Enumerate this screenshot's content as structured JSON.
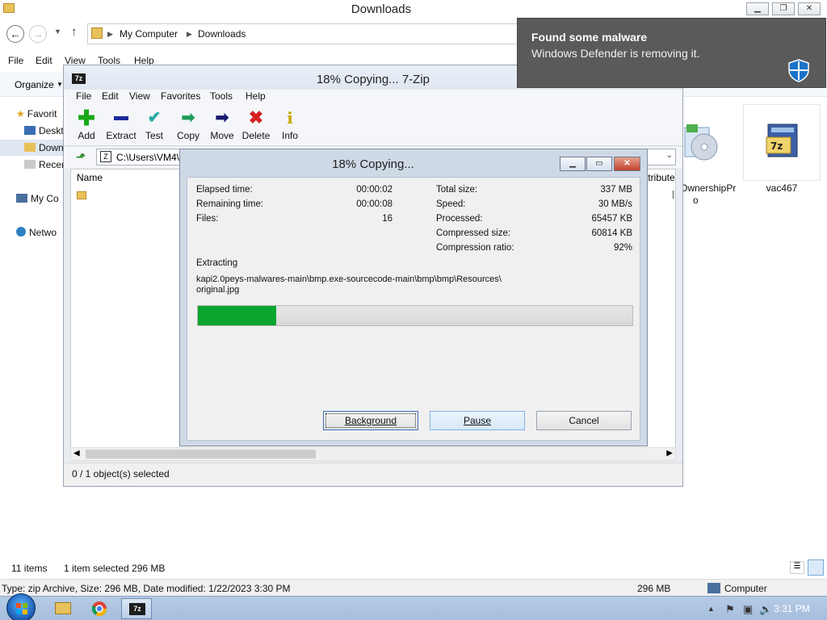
{
  "explorer": {
    "title": "Downloads",
    "address_parts": [
      "My Computer",
      "Downloads"
    ],
    "menu": [
      "File",
      "Edit",
      "View",
      "Tools",
      "Help"
    ],
    "organize_label": "Organize",
    "nav_items": [
      "Favorit",
      "Deskt",
      "Down",
      "Recen",
      "My Co",
      "Netwo"
    ],
    "files": [
      {
        "name": "OwnershipPr",
        "name2": "o",
        "icon": "disc-setup-icon"
      },
      {
        "name": "vac467",
        "icon": "7zip-archive-icon"
      }
    ],
    "status": {
      "items": "11 items",
      "selected": "1 item selected  296 MB"
    },
    "details": {
      "type_text": "Type: zip Archive, Size: 296 MB, Date modified: 1/22/2023 3:30 PM",
      "size": "296 MB",
      "location": "Computer"
    }
  },
  "sevenzip": {
    "title": "18% Copying... 7-Zip",
    "app_icon_text": "7z",
    "menu": [
      "File",
      "Edit",
      "View",
      "Favorites",
      "Tools",
      "Help"
    ],
    "toolbar": [
      "Add",
      "Extract",
      "Test",
      "Copy",
      "Move",
      "Delete",
      "Info"
    ],
    "path": "C:\\Users\\VM4\\",
    "column_name": "Name",
    "column_attr": "ttribute",
    "status": "0 / 1 object(s) selected"
  },
  "dialog": {
    "title": "18% Copying...",
    "elapsed_label": "Elapsed time:",
    "elapsed": "00:00:02",
    "remaining_label": "Remaining time:",
    "remaining": "00:00:08",
    "files_label": "Files:",
    "files": "16",
    "total_label": "Total size:",
    "total": "337 MB",
    "speed_label": "Speed:",
    "speed": "30 MB/s",
    "processed_label": "Processed:",
    "processed": "65457 KB",
    "compressed_label": "Compressed size:",
    "compressed": "60814 KB",
    "ratio_label": "Compression ratio:",
    "ratio": "92%",
    "operation": "Extracting",
    "path_line1": "kapi2.0peys-malwares-main\\bmp.exe-sourcecode-main\\bmp\\bmp\\Resources\\",
    "path_line2": "original.jpg",
    "progress_fraction": 0.18,
    "buttons": {
      "background": "Background",
      "pause": "Pause",
      "cancel": "Cancel"
    }
  },
  "toast": {
    "title": "Found some malware",
    "message": "Windows Defender is removing it."
  },
  "taskbar": {
    "clock": "3:31 PM",
    "apps": [
      "file-explorer",
      "chrome",
      "7zip"
    ]
  },
  "colors": {
    "progress": "#0aa52f",
    "toast_bg": "#5a5a5a",
    "shield": "#1a73c8"
  }
}
